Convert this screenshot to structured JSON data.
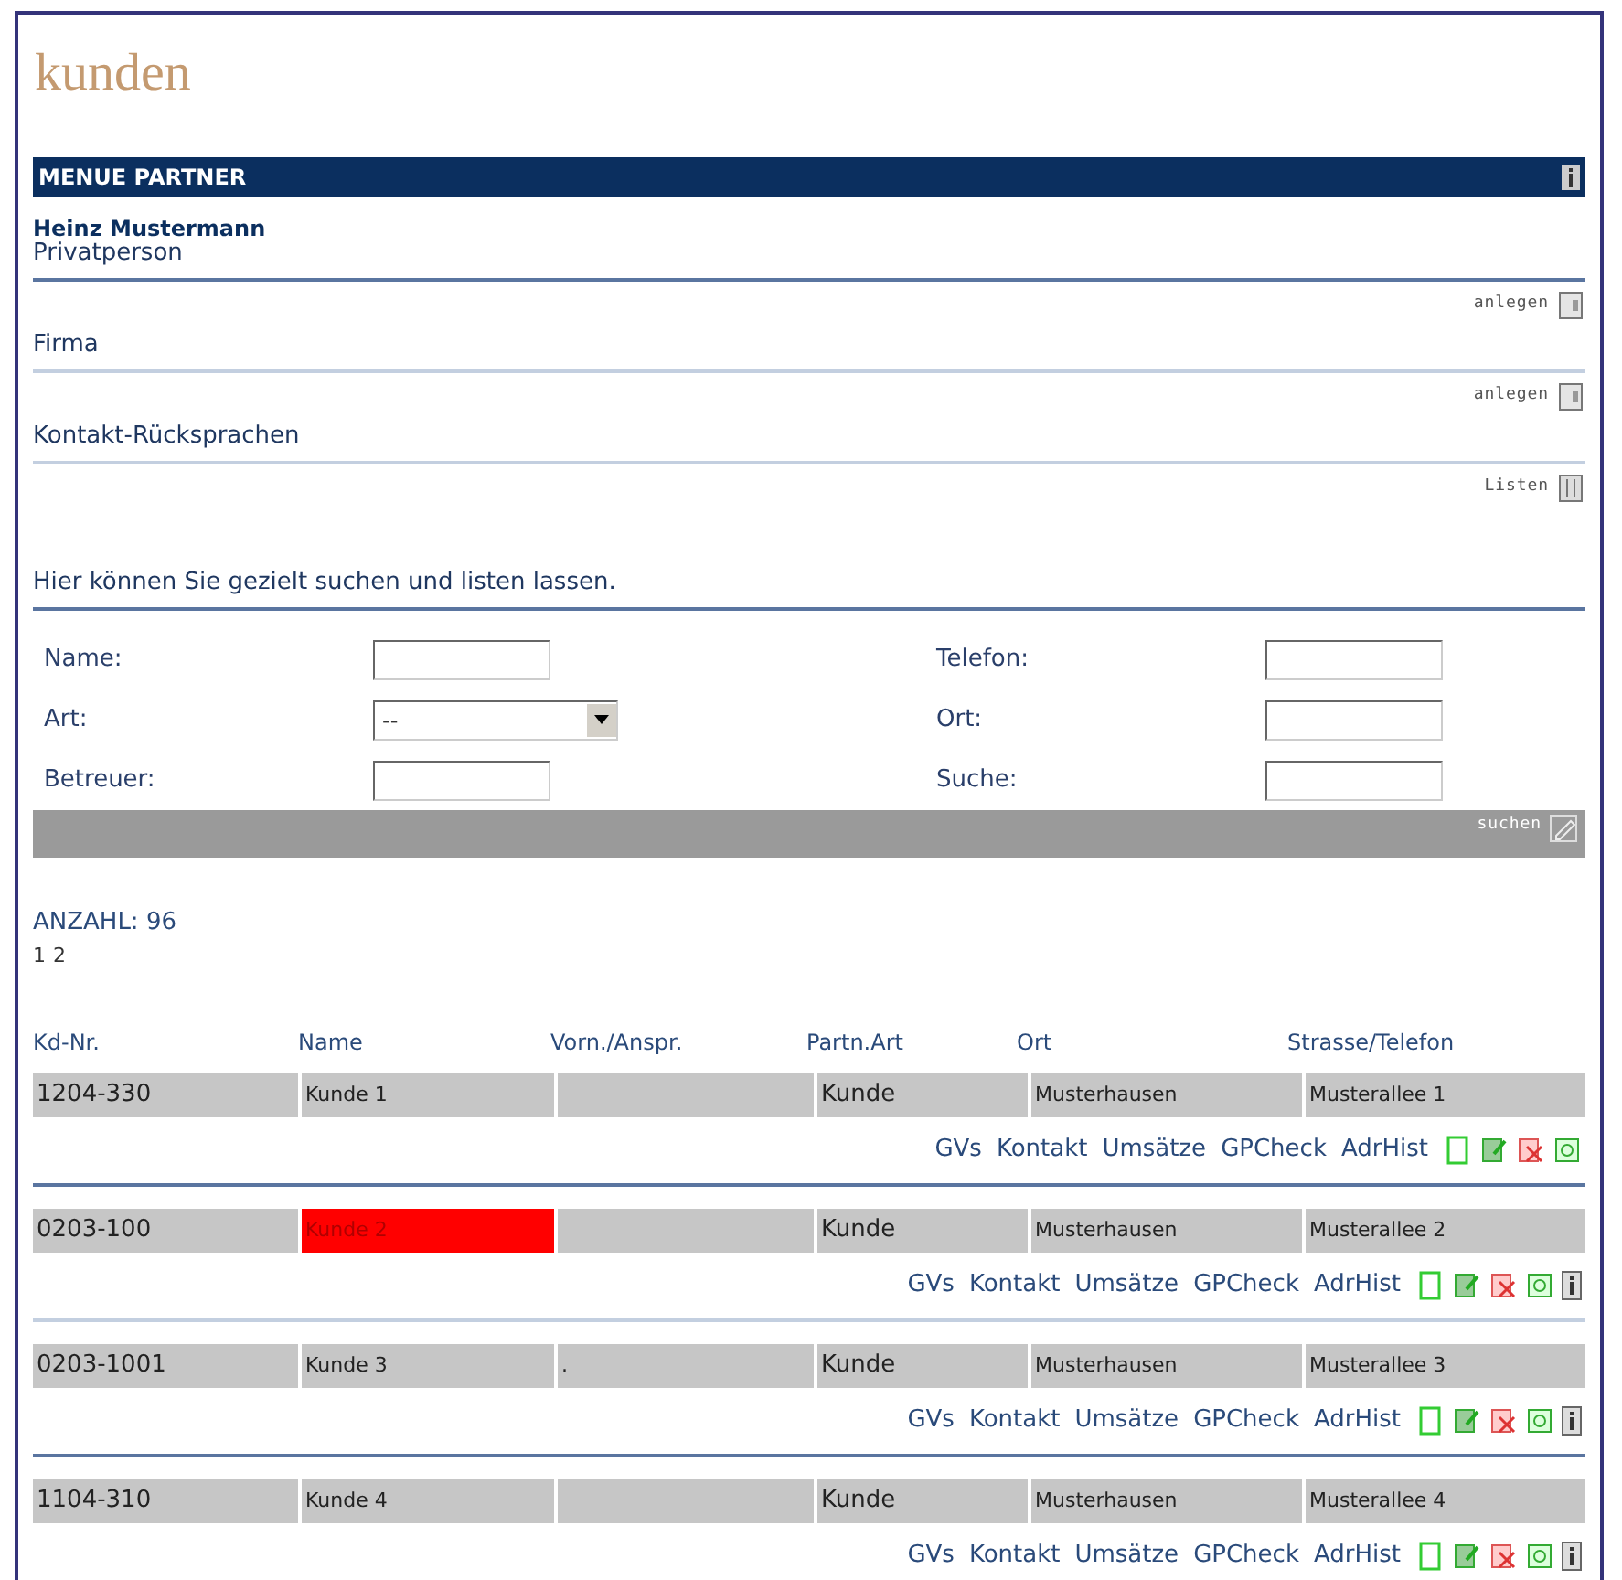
{
  "title": "kunden",
  "menu": {
    "title": "MENUE PARTNER"
  },
  "person": {
    "name": "Heinz Mustermann",
    "type": "Privatperson"
  },
  "sections": [
    {
      "action": "anlegen",
      "label": "Firma"
    },
    {
      "action": "anlegen",
      "label": "Kontakt-Rücksprachen"
    },
    {
      "action": "Listen",
      "label": "Hier können Sie gezielt suchen und listen lassen."
    }
  ],
  "form": {
    "left": [
      {
        "label": "Name:",
        "kind": "text"
      },
      {
        "label": "Art:",
        "kind": "select",
        "value": "--"
      },
      {
        "label": "Betreuer:",
        "kind": "text"
      }
    ],
    "right": [
      {
        "label": "Telefon:",
        "kind": "text"
      },
      {
        "label": "Ort:",
        "kind": "text"
      },
      {
        "label": "Suche:",
        "kind": "text"
      }
    ],
    "search_button": "suchen"
  },
  "count": "ANZAHL: 96",
  "pages": [
    "1",
    "2"
  ],
  "table": {
    "columns": [
      "Kd-Nr.",
      "Name",
      "Vorn./Anspr.",
      "Partn.Art",
      "Ort",
      "Strasse/Telefon"
    ],
    "rows": [
      {
        "cells": [
          "1204-330",
          "Kunde 1",
          "",
          "Kunde",
          "Musterhausen",
          "Musterallee 1"
        ],
        "links": [
          "GVs",
          "Kontakt",
          "Umsätze",
          "GPCheck",
          "AdrHist"
        ],
        "highlighted": false,
        "info": false
      },
      {
        "cells": [
          "0203-100",
          "Kunde 2",
          "",
          "Kunde",
          "Musterhausen",
          "Musterallee 2"
        ],
        "links": [
          "GVs",
          "Kontakt",
          "Umsätze",
          "GPCheck",
          "AdrHist"
        ],
        "highlighted": true,
        "info": true
      },
      {
        "cells": [
          "0203-1001",
          "Kunde 3",
          ".",
          "Kunde",
          "Musterhausen",
          "Musterallee 3"
        ],
        "links": [
          "GVs",
          "Kontakt",
          "Umsätze",
          "GPCheck",
          "AdrHist"
        ],
        "highlighted": false,
        "info": true
      },
      {
        "cells": [
          "1104-310",
          "Kunde 4",
          "",
          "Kunde",
          "Musterhausen",
          "Musterallee 4"
        ],
        "links": [
          "GVs",
          "Kontakt",
          "Umsätze",
          "GPCheck",
          "AdrHist"
        ],
        "highlighted": false,
        "info": true
      }
    ]
  }
}
